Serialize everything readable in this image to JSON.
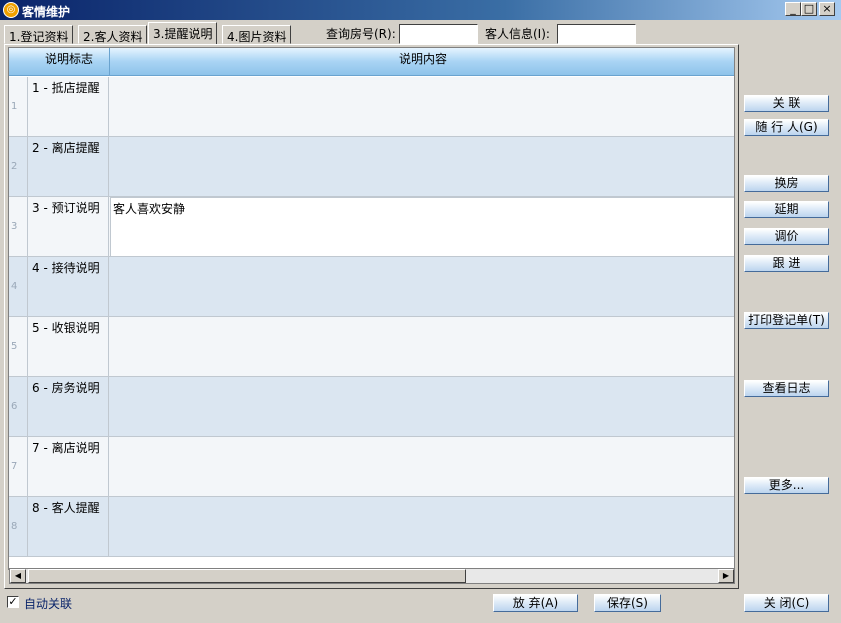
{
  "window": {
    "title": "客情维护",
    "icon": "app-logo-icon",
    "controls": [
      "_",
      "□",
      "×"
    ]
  },
  "tabs": [
    {
      "label": "1.登记资料",
      "active": false
    },
    {
      "label": "2.客人资料",
      "active": false
    },
    {
      "label": "3.提醒说明",
      "active": true
    },
    {
      "label": "4.图片资料",
      "active": false
    }
  ],
  "search": {
    "room_label": "查询房号(R):",
    "room_value": "",
    "guest_label": "客人信息(I):",
    "guest_value": ""
  },
  "grid": {
    "columns": [
      "说明标志",
      "说明内容"
    ],
    "rows": [
      {
        "num": "1",
        "flag": "1 - 抵店提醒",
        "content": ""
      },
      {
        "num": "2",
        "flag": "2 - 离店提醒",
        "content": ""
      },
      {
        "num": "3",
        "flag": "3 - 预订说明",
        "content": "客人喜欢安静"
      },
      {
        "num": "4",
        "flag": "4 - 接待说明",
        "content": ""
      },
      {
        "num": "5",
        "flag": "5 - 收银说明",
        "content": ""
      },
      {
        "num": "6",
        "flag": "6 - 房务说明",
        "content": ""
      },
      {
        "num": "7",
        "flag": "7 - 离店说明",
        "content": ""
      },
      {
        "num": "8",
        "flag": "8 - 客人提醒",
        "content": ""
      }
    ]
  },
  "side_buttons": {
    "link": "关 联",
    "companion": "随 行 人(G)",
    "change_room": "换房",
    "extend": "延期",
    "adjust_price": "调价",
    "follow_up": "跟 进",
    "print": "打印登记单(T)",
    "view_log": "查看日志",
    "more": "更多..."
  },
  "bottom": {
    "auto_link_label": "自动关联",
    "auto_link_checked": true,
    "discard": "放 弃(A)",
    "save": "保存(S)",
    "close": "关 闭(C)"
  }
}
